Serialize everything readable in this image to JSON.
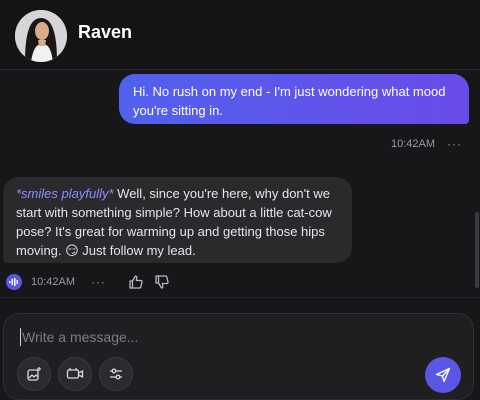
{
  "header": {
    "name": "Raven",
    "avatar_icon": "profile-photo-avatar"
  },
  "messages": [
    {
      "sender": "user",
      "text": "Hi. No rush on my end - I'm just wondering what mood you're sitting in.",
      "time": "10:42AM",
      "more": "···"
    },
    {
      "sender": "bot",
      "action": "*smiles playfully*",
      "text": " Well, since you're here, why don't we start with something simple? How about a little cat-cow pose? It's great for warming up and getting those hips moving. 😏 Just follow my lead.",
      "time": "10:42AM",
      "more": "···"
    }
  ],
  "composer": {
    "placeholder": "Write a message...",
    "value": ""
  },
  "colors": {
    "accent": "#5b57e6",
    "user_bubble_start": "#5161ee",
    "user_bubble_end": "#6a4be9",
    "bot_bubble": "#2a2a2d",
    "action_text": "#8f8dff"
  },
  "icons": {
    "voice": "audio-wave-icon",
    "like": "thumbs-up-icon",
    "dislike": "thumbs-down-icon",
    "image": "image-sparkle-icon",
    "video": "video-camera-icon",
    "settings": "sliders-icon",
    "send": "send-icon"
  }
}
